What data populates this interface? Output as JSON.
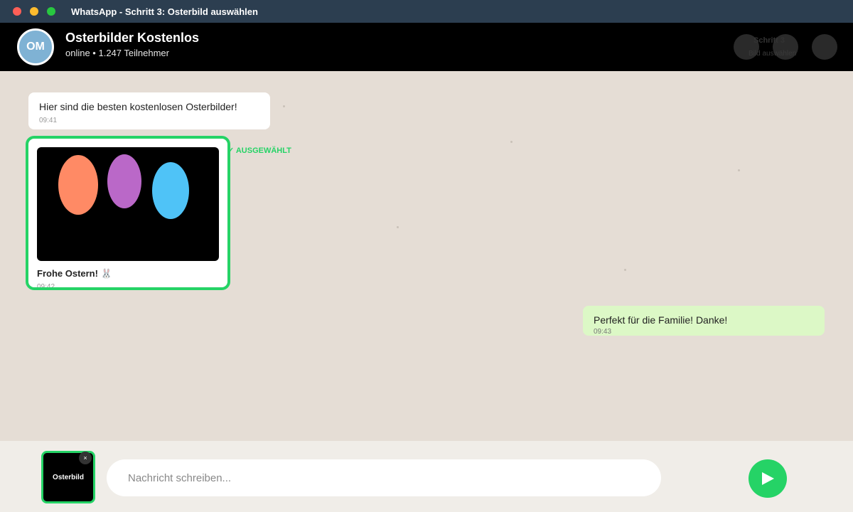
{
  "window": {
    "title": "WhatsApp - Schritt 3: Osterbild auswählen"
  },
  "header": {
    "avatar_initials": "OM",
    "group_name": "Osterbilder Kostenlos",
    "status": "online • 1.247 Teilnehmer",
    "step_title": "Schritt 3",
    "step_subtitle": "Bild auswählen"
  },
  "messages": [
    {
      "type": "incoming",
      "text": "Hier sind die besten kostenlosen Osterbilder!",
      "time": "09:41"
    },
    {
      "type": "image",
      "caption": "Frohe Ostern! 🐰",
      "time": "09:42",
      "selected_label": "✓ AUSGEWÄHLT",
      "egg_colors": [
        "#ff8a65",
        "#ba68c8",
        "#4fc3f7"
      ]
    },
    {
      "type": "outgoing",
      "text": "Perfekt für die Familie! Danke!",
      "time": "09:43"
    }
  ],
  "composer": {
    "attachment_label": "Osterbild",
    "remove_label": "×",
    "placeholder": "Nachricht schreiben...",
    "send_icon": "send-icon"
  },
  "colors": {
    "accent": "#25d366",
    "header_bg": "#000000",
    "titlebar_bg": "#2c3e50",
    "chat_bg": "#e5ddd5",
    "outgoing_bubble": "#dcf8c6"
  }
}
